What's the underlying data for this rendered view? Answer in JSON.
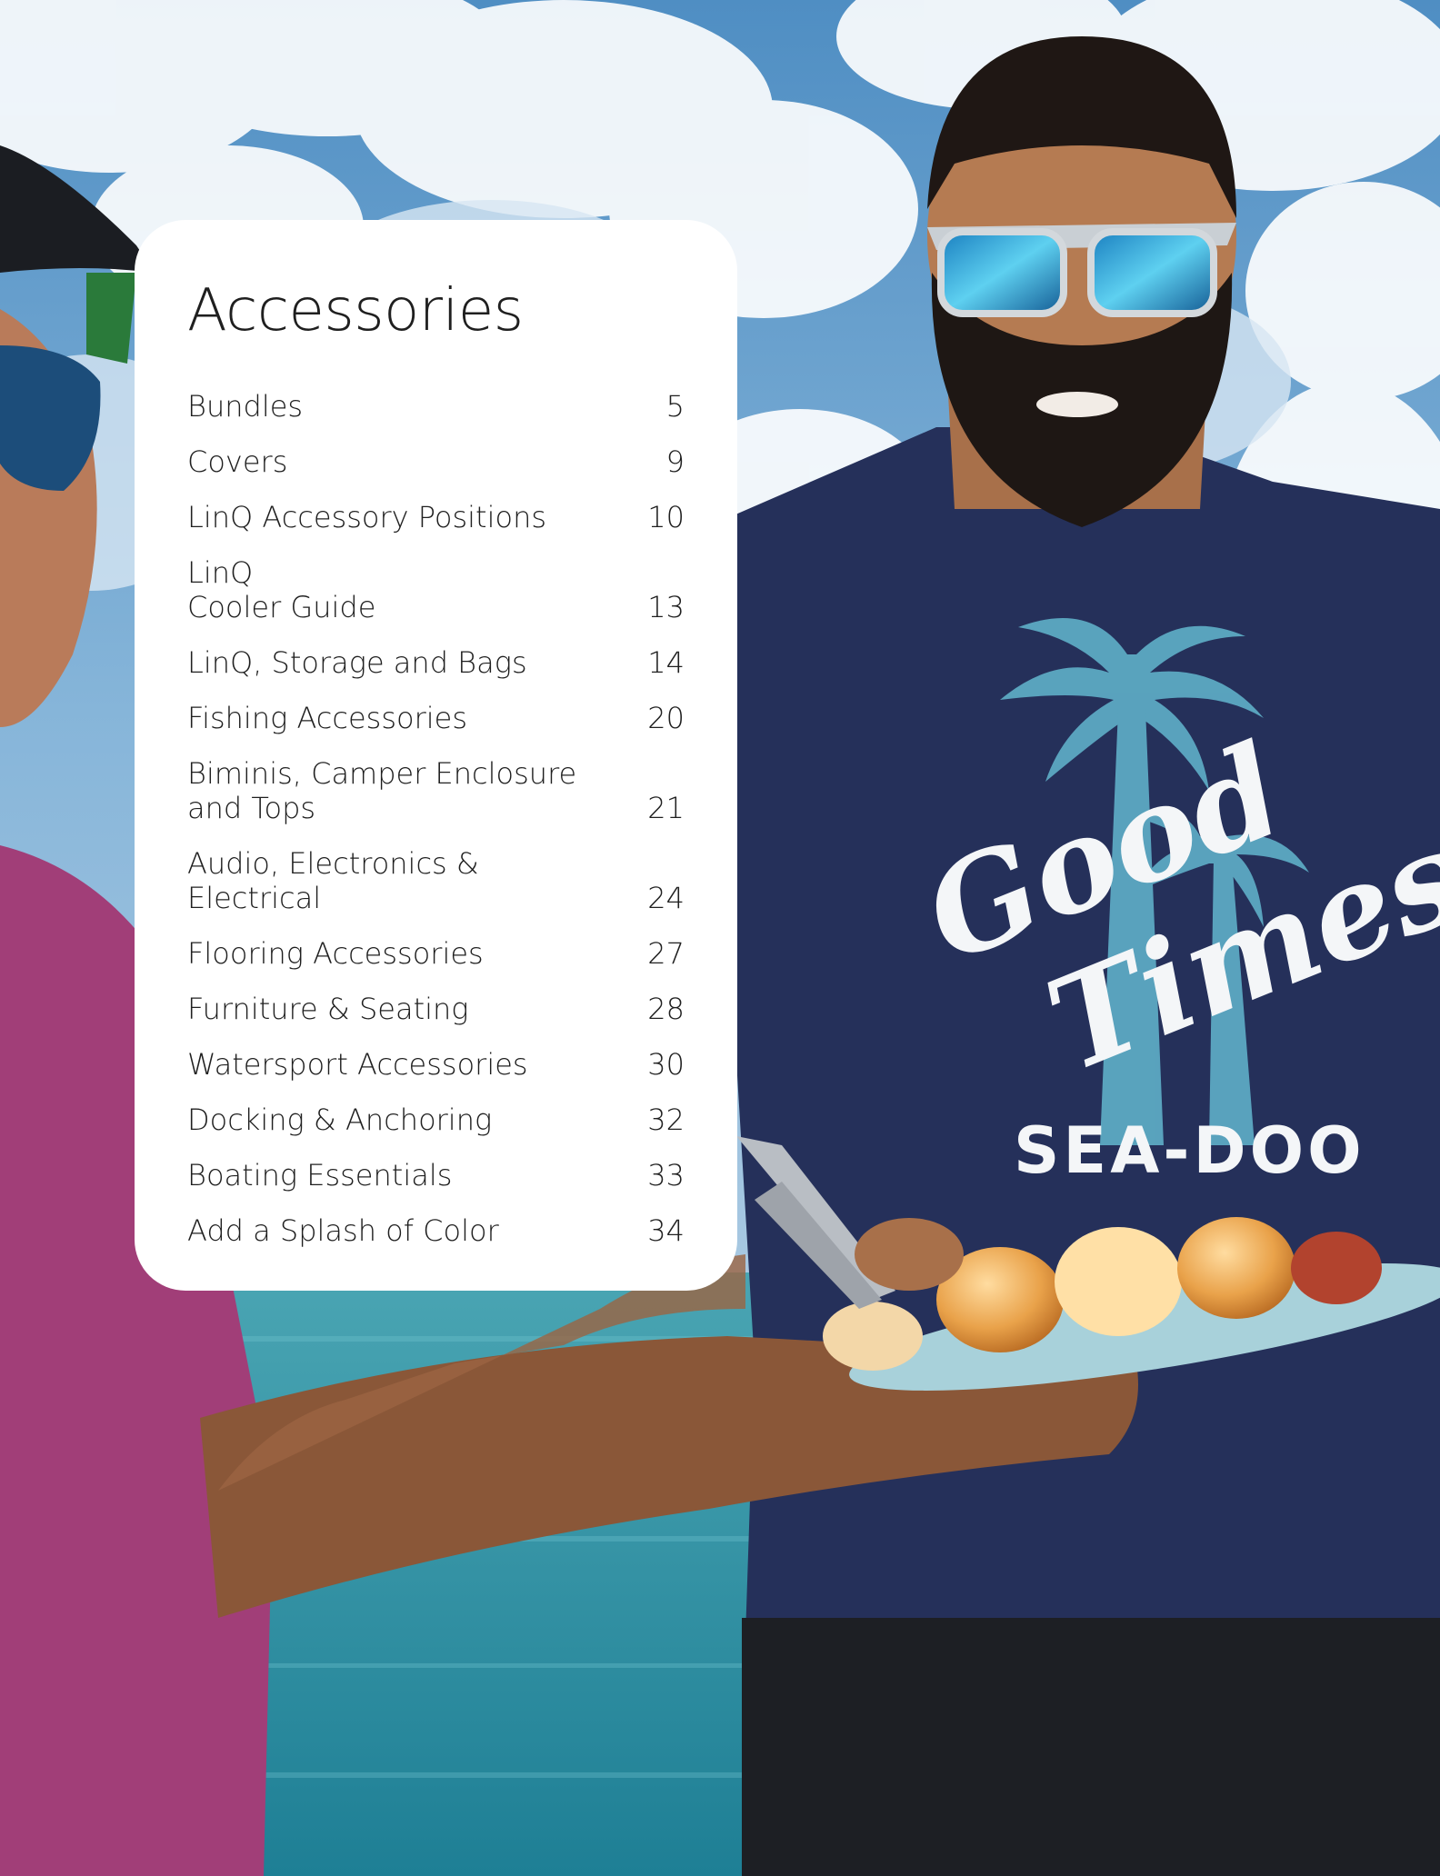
{
  "toc": {
    "title": "Accessories",
    "items": [
      {
        "label": "Bundles",
        "page": "5"
      },
      {
        "label": "Covers",
        "page": "9"
      },
      {
        "label": "LinQ Accessory Positions",
        "page": "10"
      },
      {
        "label": "LinQ\nCooler Guide",
        "page": "13"
      },
      {
        "label": "LinQ, Storage and Bags",
        "page": "14"
      },
      {
        "label": "Fishing Accessories",
        "page": "20"
      },
      {
        "label": "Biminis, Camper Enclosure\nand Tops",
        "page": "21"
      },
      {
        "label": "Audio, Electronics & Electrical",
        "page": "24"
      },
      {
        "label": "Flooring Accessories",
        "page": "27"
      },
      {
        "label": "Furniture & Seating",
        "page": "28"
      },
      {
        "label": "Watersport Accessories",
        "page": "30"
      },
      {
        "label": "Docking & Anchoring",
        "page": "32"
      },
      {
        "label": "Boating Essentials",
        "page": "33"
      },
      {
        "label": "Add a Splash of Color",
        "page": "34"
      }
    ]
  },
  "photo": {
    "shirt_text_1": "Good",
    "shirt_text_2": "Times",
    "shirt_brand": "SEA-DOO"
  },
  "colors": {
    "card_background": "#ffffff",
    "text": "#1f1f1f",
    "sky": "#5e95c2",
    "sea": "#2f8ea0",
    "shirt": "#252f55",
    "pink_shirt": "#a33f7a"
  }
}
